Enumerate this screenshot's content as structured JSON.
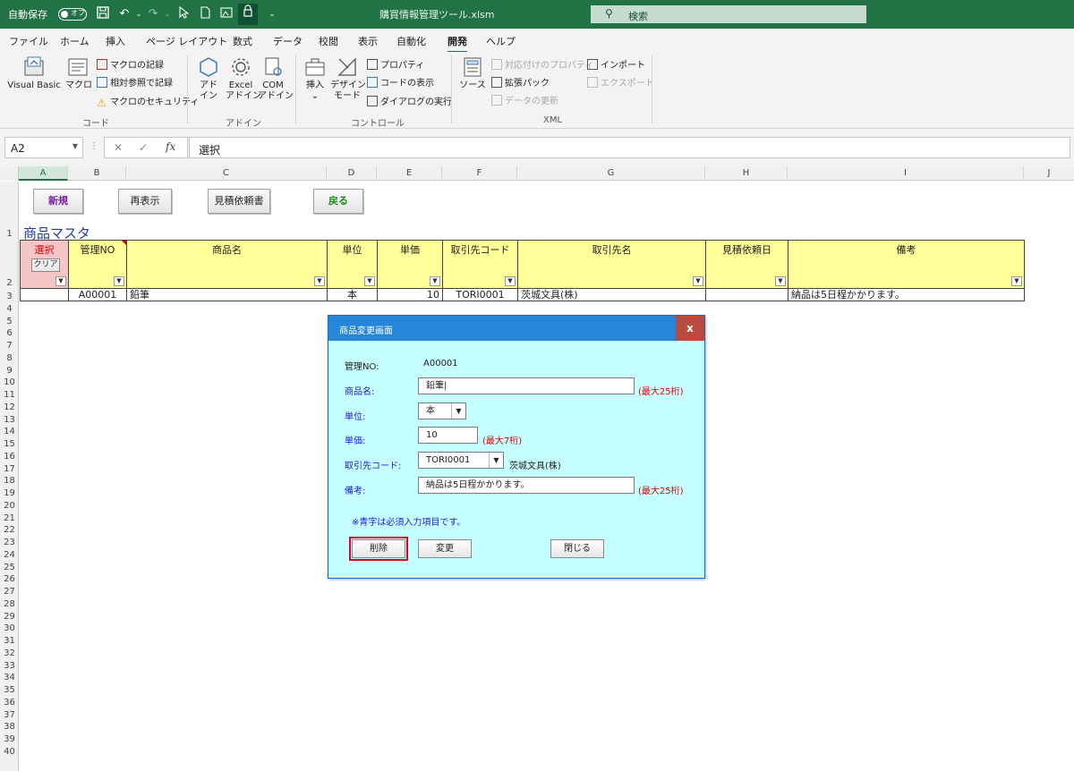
{
  "titlebar": {
    "autosave_label": "自動保存",
    "autosave_state": "オフ",
    "filename": "購買情報管理ツール.xlsm",
    "search_placeholder": "検索"
  },
  "menu_tabs": [
    "ファイル",
    "ホーム",
    "挿入",
    "ページ レイアウト",
    "数式",
    "データ",
    "校閲",
    "表示",
    "自動化",
    "開発",
    "ヘルプ"
  ],
  "active_tab": "開発",
  "ribbon": {
    "code": {
      "visual_basic": "Visual Basic",
      "macro": "マクロ",
      "record_macro": "マクロの記録",
      "relative_ref": "相対参照で記録",
      "macro_security": "マクロのセキュリティ",
      "group_label": "コード"
    },
    "addins": {
      "addin_1": "アド",
      "addin_2": "イン",
      "excel_1": "Excel",
      "excel_2": "アドイン",
      "com_1": "COM",
      "com_2": "アドイン",
      "group_label": "アドイン"
    },
    "controls": {
      "insert": "挿入",
      "design_1": "デザイン",
      "design_2": "モード",
      "properties": "プロパティ",
      "view_code": "コードの表示",
      "run_dialog": "ダイアログの実行",
      "group_label": "コントロール"
    },
    "xml": {
      "source": "ソース",
      "map_properties": "対応付けのプロパティ",
      "expansion_packs": "拡張パック",
      "refresh_data": "データの更新",
      "import": "インポート",
      "export": "エクスポート",
      "group_label": "XML"
    }
  },
  "formula_bar": {
    "name_box": "A2",
    "fx": "fx",
    "content": "選択"
  },
  "columns": [
    "A",
    "B",
    "C",
    "D",
    "E",
    "F",
    "G",
    "H",
    "I",
    "J"
  ],
  "rows": [
    "1",
    "2",
    "3",
    "4",
    "5",
    "6",
    "7",
    "8",
    "9",
    "10",
    "11",
    "12",
    "13",
    "14",
    "15",
    "16",
    "17",
    "18",
    "19",
    "20",
    "21",
    "22",
    "23",
    "24",
    "25",
    "26",
    "27",
    "28",
    "29",
    "30",
    "31",
    "32",
    "33",
    "34",
    "35",
    "36",
    "37",
    "38",
    "39",
    "40"
  ],
  "sheet": {
    "buttons": {
      "new": "新規",
      "redisplay": "再表示",
      "quote_request": "見積依頼書",
      "back": "戻る"
    },
    "title": "商品マスタ",
    "headers": {
      "select": "選択",
      "clear": "クリア",
      "mgmt_no": "管理NO",
      "product_name": "商品名",
      "unit": "単位",
      "unit_price": "単価",
      "supplier_code": "取引先コード",
      "supplier_name": "取引先名",
      "quote_date": "見積依頼日",
      "remarks": "備考"
    },
    "row3": {
      "mgmt_no": "A00001",
      "product_name": "鉛筆",
      "unit": "本",
      "unit_price": "10",
      "supplier_code": "TORI0001",
      "supplier_name": "茨城文具(株)",
      "quote_date": "",
      "remarks": "納品は5日程かかります。"
    }
  },
  "dialog": {
    "title": "商品変更画面",
    "close": "x",
    "mgmt_no_label": "管理NO:",
    "mgmt_no_value": "A00001",
    "product_label": "商品名:",
    "product_value": "鉛筆|",
    "product_hint": "(最大25桁)",
    "unit_label": "単位:",
    "unit_value": "本",
    "price_label": "単価:",
    "price_value": "10",
    "price_hint": "(最大7桁)",
    "supplier_label": "取引先コード:",
    "supplier_value": "TORI0001",
    "supplier_name": "茨城文具(株)",
    "remarks_label": "備考:",
    "remarks_value": "納品は5日程かかります。",
    "remarks_hint": "(最大25桁)",
    "note": "※青字は必須入力項目です。",
    "delete_button": "削除",
    "change_button": "変更",
    "close_button": "閉じる"
  },
  "colors": {
    "excel_green": "#217346",
    "header_yellow": "#ffff99",
    "dialog_bg": "#c6ffff",
    "dialog_title": "#2886d9",
    "required_blue": "#1a1ae0",
    "hint_red": "#e00000"
  }
}
